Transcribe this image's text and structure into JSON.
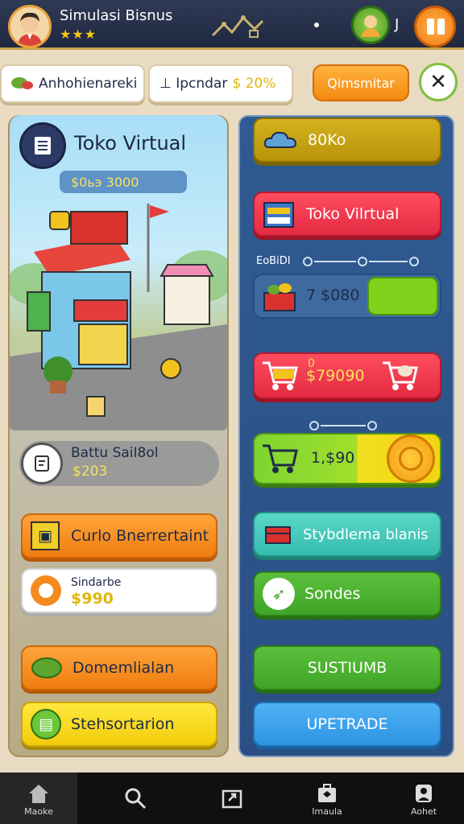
{
  "header": {
    "title": "Simulasi Bisnus",
    "stars": "★★★",
    "counter": "J"
  },
  "toolbar": {
    "left_pill": "Anhohienareki",
    "right_pill_prefix": "⊥ Ipcndar",
    "right_pill_value": "$ 20%",
    "orange_button": "Qimsmitar"
  },
  "left": {
    "store_title": "Toko Virtual",
    "store_price": "$0ьэ 3000",
    "stat_label": "Battu SaiI8ol",
    "stat_value": "$203",
    "buttons": [
      {
        "label": "Curlo Bnerrertaint"
      },
      {
        "sub": "Sindarbe",
        "value": "$990"
      },
      {
        "label": "Domemlialan"
      },
      {
        "label": "Stehsortarion"
      }
    ]
  },
  "right": {
    "buttons": [
      {
        "label": "80Ko"
      },
      {
        "label": "Toko Vilrtual"
      },
      {
        "label": "Stybdlema blanis"
      },
      {
        "label": "Sondes"
      },
      {
        "label": "SUSTIUMB"
      },
      {
        "label": "UPETRADE"
      }
    ],
    "slider_label": "EoBiDI",
    "small_card_value": "7 $080",
    "cart_value": "$79090",
    "cart_prefix": "0",
    "coin_card_value": "1,$90"
  },
  "nav": {
    "items": [
      {
        "label": "Maoke",
        "icon": "home-icon"
      },
      {
        "label": "",
        "icon": "search-icon"
      },
      {
        "label": "",
        "icon": "upload-icon"
      },
      {
        "label": "Imaula",
        "icon": "briefcase-icon"
      },
      {
        "label": "Aohet",
        "icon": "user-icon"
      }
    ]
  },
  "colors": {
    "accent_orange": "#f48a10",
    "accent_blue": "#2f5b92",
    "accent_red": "#e32a42",
    "accent_green": "#3fa427",
    "money_yellow": "#f6e35a"
  }
}
